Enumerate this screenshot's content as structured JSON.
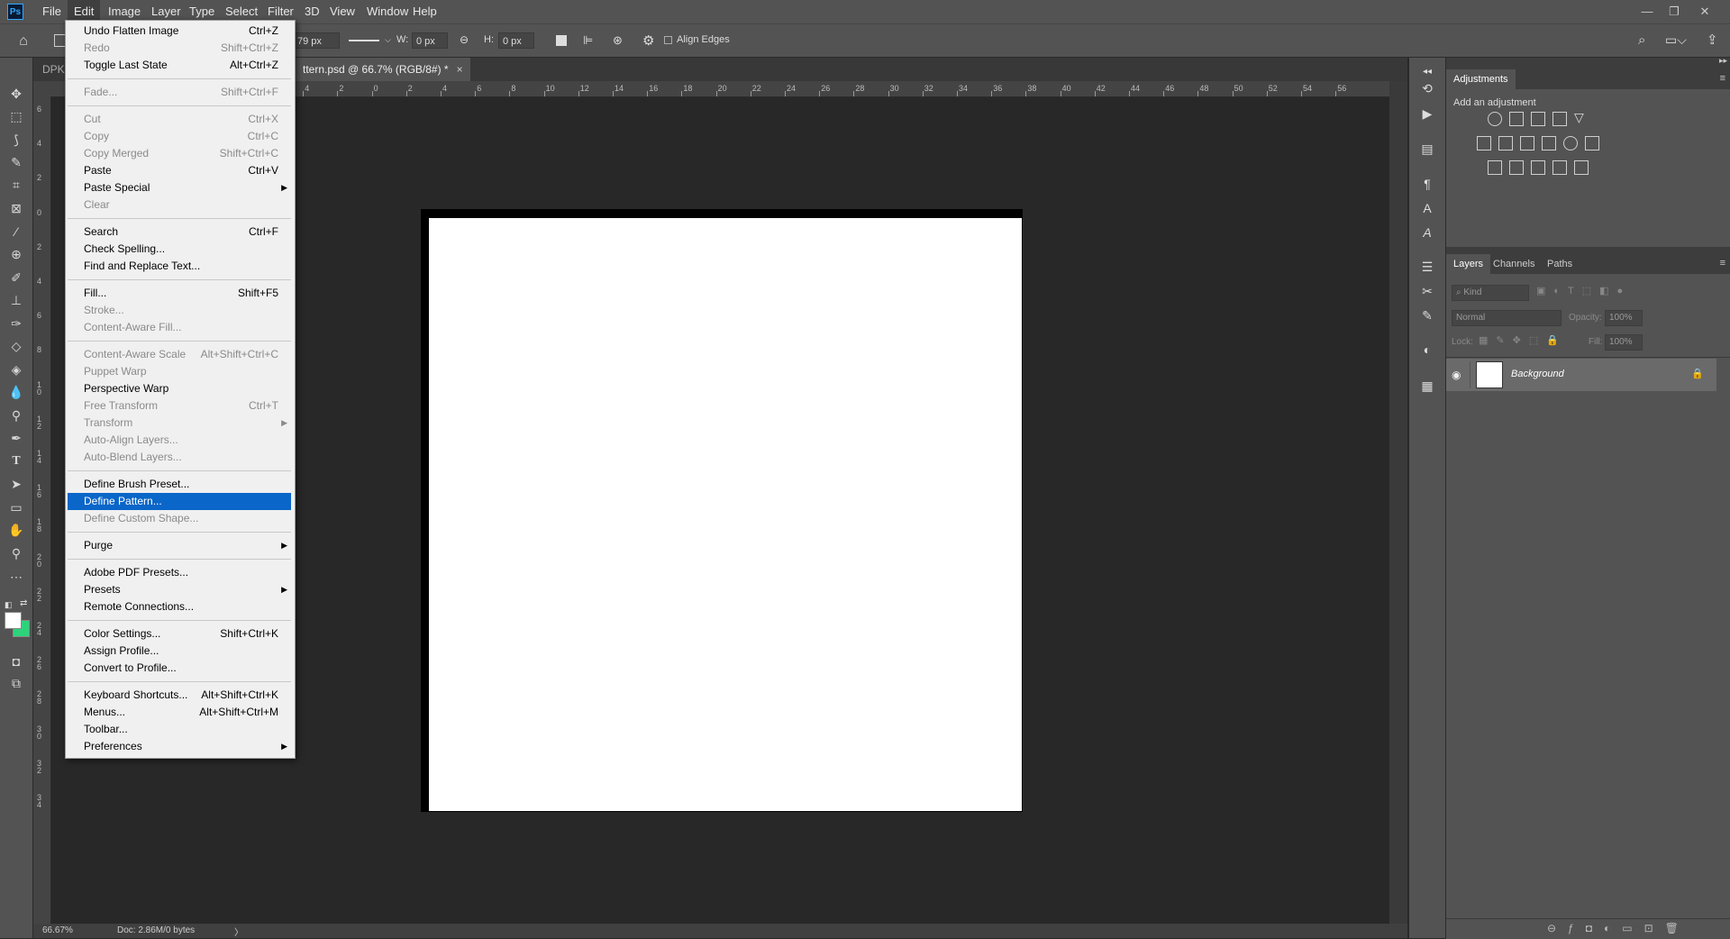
{
  "menubar": {
    "items": [
      "File",
      "Edit",
      "Image",
      "Layer",
      "Type",
      "Select",
      "Filter",
      "3D",
      "View",
      "Window",
      "Help"
    ],
    "active": "Edit"
  },
  "options": {
    "size_value": "79 px",
    "w_label": "W:",
    "w_value": "0 px",
    "h_label": "H:",
    "h_value": "0 px",
    "align_edges": "Align Edges"
  },
  "tabs": {
    "tab1": "DPK",
    "tab2": "ttern.psd @ 66.7% (RGB/8#) *",
    "close": "×"
  },
  "ruler": {
    "h_labels": [
      "6",
      "4",
      "2",
      "0",
      "2",
      "4",
      "6",
      "8",
      "10",
      "12",
      "14",
      "16",
      "18",
      "20",
      "22",
      "24",
      "26",
      "28",
      "30",
      "32",
      "34",
      "36",
      "38",
      "40",
      "42",
      "44",
      "46",
      "48",
      "50",
      "52",
      "54",
      "56"
    ],
    "v_labels": [
      "6",
      "4",
      "2",
      "0",
      "2",
      "4",
      "6",
      "8",
      "10",
      "12",
      "14",
      "16",
      "18",
      "20",
      "22",
      "24",
      "26",
      "28",
      "30",
      "32",
      "34"
    ]
  },
  "edit_menu": {
    "items": [
      {
        "label": "Undo Flatten Image",
        "shortcut": "Ctrl+Z",
        "disabled": false
      },
      {
        "label": "Redo",
        "shortcut": "Shift+Ctrl+Z",
        "disabled": true
      },
      {
        "label": "Toggle Last State",
        "shortcut": "Alt+Ctrl+Z",
        "disabled": false
      },
      {
        "label": "Fade...",
        "shortcut": "Shift+Ctrl+F",
        "disabled": true
      },
      {
        "label": "Cut",
        "shortcut": "Ctrl+X",
        "disabled": true
      },
      {
        "label": "Copy",
        "shortcut": "Ctrl+C",
        "disabled": true
      },
      {
        "label": "Copy Merged",
        "shortcut": "Shift+Ctrl+C",
        "disabled": true
      },
      {
        "label": "Paste",
        "shortcut": "Ctrl+V",
        "disabled": false
      },
      {
        "label": "Paste Special",
        "shortcut": "",
        "disabled": false,
        "submenu": true
      },
      {
        "label": "Clear",
        "shortcut": "",
        "disabled": true
      },
      {
        "label": "Search",
        "shortcut": "Ctrl+F",
        "disabled": false
      },
      {
        "label": "Check Spelling...",
        "shortcut": "",
        "disabled": false
      },
      {
        "label": "Find and Replace Text...",
        "shortcut": "",
        "disabled": false
      },
      {
        "label": "Fill...",
        "shortcut": "Shift+F5",
        "disabled": false
      },
      {
        "label": "Stroke...",
        "shortcut": "",
        "disabled": true
      },
      {
        "label": "Content-Aware Fill...",
        "shortcut": "",
        "disabled": true
      },
      {
        "label": "Content-Aware Scale",
        "shortcut": "Alt+Shift+Ctrl+C",
        "disabled": true
      },
      {
        "label": "Puppet Warp",
        "shortcut": "",
        "disabled": true
      },
      {
        "label": "Perspective Warp",
        "shortcut": "",
        "disabled": false
      },
      {
        "label": "Free Transform",
        "shortcut": "Ctrl+T",
        "disabled": true
      },
      {
        "label": "Transform",
        "shortcut": "",
        "disabled": true,
        "submenu": true
      },
      {
        "label": "Auto-Align Layers...",
        "shortcut": "",
        "disabled": true
      },
      {
        "label": "Auto-Blend Layers...",
        "shortcut": "",
        "disabled": true
      },
      {
        "label": "Define Brush Preset...",
        "shortcut": "",
        "disabled": false
      },
      {
        "label": "Define Pattern...",
        "shortcut": "",
        "disabled": false,
        "highlighted": true
      },
      {
        "label": "Define Custom Shape...",
        "shortcut": "",
        "disabled": true
      },
      {
        "label": "Purge",
        "shortcut": "",
        "disabled": false,
        "submenu": true
      },
      {
        "label": "Adobe PDF Presets...",
        "shortcut": "",
        "disabled": false
      },
      {
        "label": "Presets",
        "shortcut": "",
        "disabled": false,
        "submenu": true
      },
      {
        "label": "Remote Connections...",
        "shortcut": "",
        "disabled": false
      },
      {
        "label": "Color Settings...",
        "shortcut": "Shift+Ctrl+K",
        "disabled": false
      },
      {
        "label": "Assign Profile...",
        "shortcut": "",
        "disabled": false
      },
      {
        "label": "Convert to Profile...",
        "shortcut": "",
        "disabled": false
      },
      {
        "label": "Keyboard Shortcuts...",
        "shortcut": "Alt+Shift+Ctrl+K",
        "disabled": false
      },
      {
        "label": "Menus...",
        "shortcut": "Alt+Shift+Ctrl+M",
        "disabled": false
      },
      {
        "label": "Toolbar...",
        "shortcut": "",
        "disabled": false
      },
      {
        "label": "Preferences",
        "shortcut": "",
        "disabled": false,
        "submenu": true
      }
    ]
  },
  "adjustments": {
    "title": "Adjustments",
    "subtitle": "Add an adjustment"
  },
  "layers": {
    "tabs": [
      "Layers",
      "Channels",
      "Paths"
    ],
    "kind_placeholder": "Kind",
    "blend_mode": "Normal",
    "opacity_label": "Opacity:",
    "opacity_value": "100%",
    "lock_label": "Lock:",
    "fill_label": "Fill:",
    "fill_value": "100%",
    "layer_name": "Background"
  },
  "status": {
    "zoom": "66.67%",
    "doc": "Doc: 2.86M/0 bytes",
    "arrow": "〉"
  },
  "colors": {
    "foreground": "#ffffff",
    "background": "#2dd37a",
    "highlight": "#0a66c8"
  }
}
